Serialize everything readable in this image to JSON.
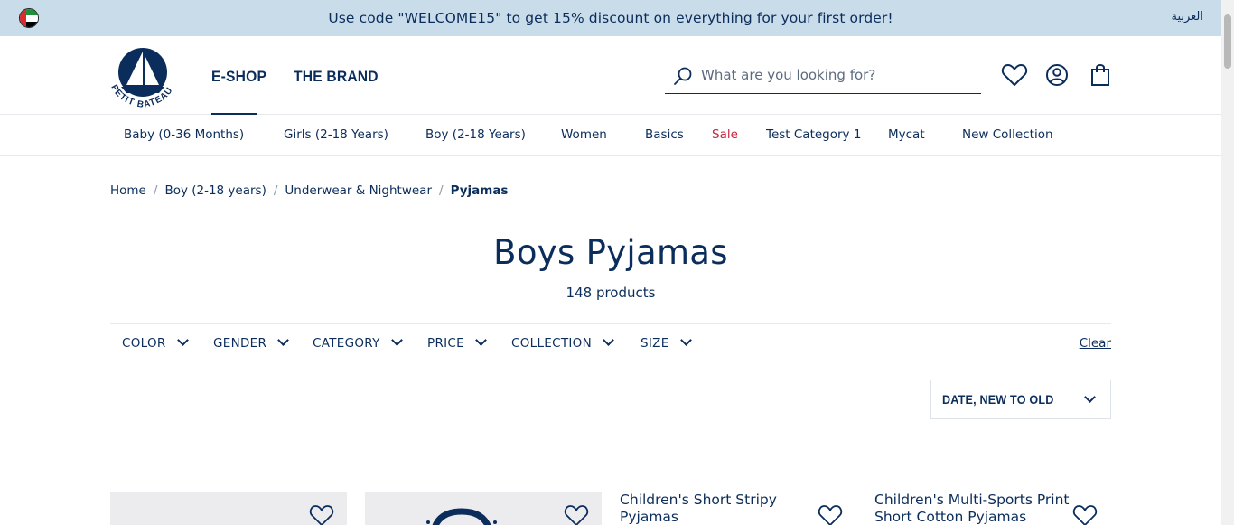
{
  "promo": {
    "text": "Use code \"WELCOME15\" to get 15% discount on everything for your first order!",
    "language_link": "العربية",
    "flag_icon": "uae-flag-icon"
  },
  "header": {
    "logo_text": "PETIT BATEAU",
    "nav": [
      "E-SHOP",
      "THE BRAND"
    ],
    "active_nav": "E-SHOP",
    "search_placeholder": "What are you looking for?",
    "icons": [
      "search-icon",
      "heart-icon",
      "account-icon",
      "bag-icon"
    ]
  },
  "categories": [
    {
      "label": "Baby (0-36 Months)"
    },
    {
      "label": "Girls (2-18 Years)"
    },
    {
      "label": "Boy (2-18 Years)"
    },
    {
      "label": "Women"
    },
    {
      "label": "Basics"
    },
    {
      "label": "Sale"
    },
    {
      "label": "Test Category 1"
    },
    {
      "label": "Mycat"
    },
    {
      "label": "New Collection"
    }
  ],
  "breadcrumb": {
    "items": [
      "Home",
      "Boy (2-18 years)",
      "Underwear & Nightwear"
    ],
    "separator": "/",
    "current": "Pyjamas"
  },
  "page": {
    "title": "Boys Pyjamas",
    "count": "148 products"
  },
  "filters": {
    "items": [
      "COLOR",
      "GENDER",
      "CATEGORY",
      "PRICE",
      "COLLECTION",
      "SIZE"
    ],
    "clear_label": "Clear"
  },
  "sort": {
    "selected": "DATE, NEW TO OLD"
  },
  "products": [
    {
      "alt": ""
    },
    {
      "alt": ""
    },
    {
      "alt": "Children's Short Stripy Pyjamas"
    },
    {
      "alt": "Children's Multi-Sports Print Short Cotton Pyjamas"
    }
  ],
  "colors": {
    "navy": "#0b2d5b",
    "promo_bg": "#c9dcea",
    "sale_red": "#c4243f"
  }
}
